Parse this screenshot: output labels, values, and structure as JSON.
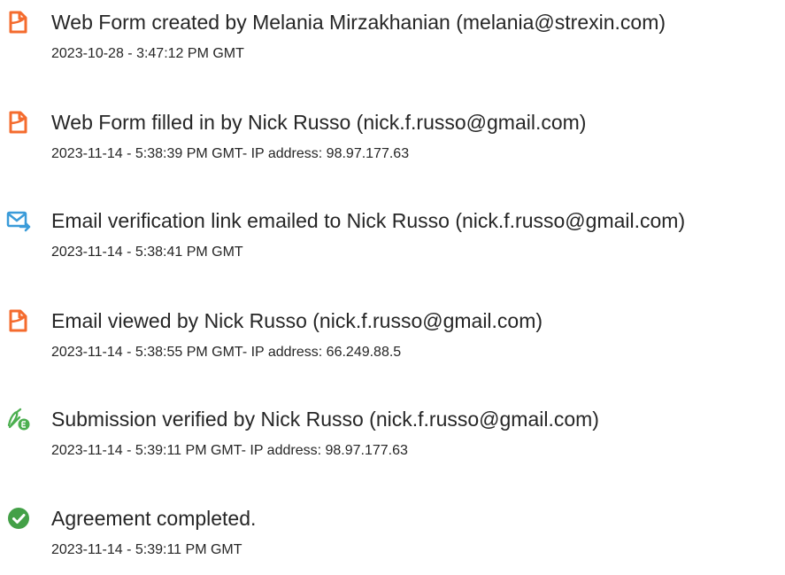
{
  "colors": {
    "document_icon": "#F46B2E",
    "email_icon": "#3A9BD9",
    "signature_icon": "#4CAF50",
    "completed_icon": "#43A047",
    "text": "#262626"
  },
  "events": [
    {
      "icon": "document-icon",
      "title": "Web Form created by Melania Mirzakhanian (melania@strexin.com)",
      "meta": "2023-10-28 - 3:47:12 PM GMT"
    },
    {
      "icon": "document-icon",
      "title": "Web Form filled in by Nick Russo (nick.f.russo@gmail.com)",
      "meta": "2023-11-14 - 5:38:39 PM GMT- IP address: 98.97.177.63"
    },
    {
      "icon": "email-send-icon",
      "title": "Email verification link emailed to Nick Russo (nick.f.russo@gmail.com)",
      "meta": "2023-11-14 - 5:38:41 PM GMT"
    },
    {
      "icon": "document-icon",
      "title": "Email viewed by Nick Russo (nick.f.russo@gmail.com)",
      "meta": "2023-11-14 - 5:38:55 PM GMT- IP address: 66.249.88.5"
    },
    {
      "icon": "signature-verified-icon",
      "title": "Submission verified by Nick Russo (nick.f.russo@gmail.com)",
      "meta": "2023-11-14 - 5:39:11 PM GMT- IP address: 98.97.177.63"
    },
    {
      "icon": "check-circle-icon",
      "title": "Agreement completed.",
      "meta": "2023-11-14 - 5:39:11 PM GMT"
    }
  ]
}
